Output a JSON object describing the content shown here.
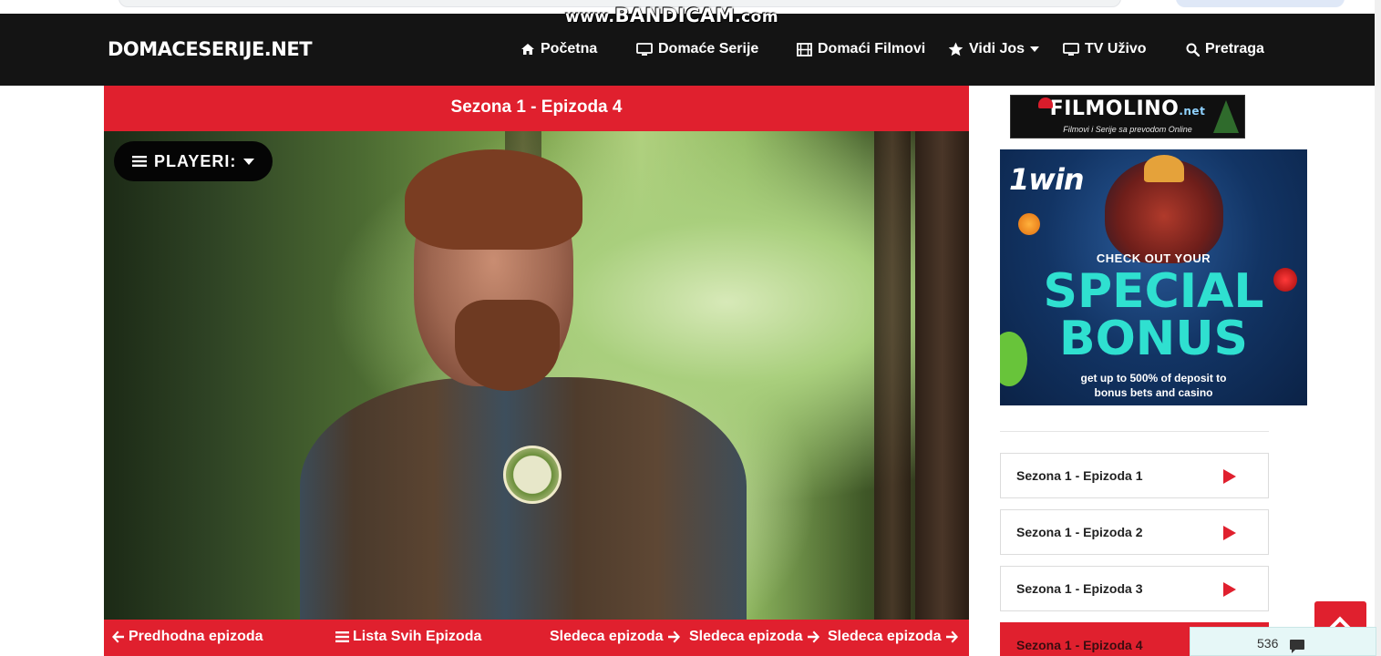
{
  "watermark": {
    "prefix": "www.",
    "brand": "BANDICAM",
    "suffix": ".com"
  },
  "site": {
    "logo": "DOMACESERIJE.NET"
  },
  "nav": [
    {
      "label": "Početna",
      "icon": "home-icon"
    },
    {
      "label": "Domaće Serije",
      "icon": "monitor-icon"
    },
    {
      "label": "Domaći Filmovi",
      "icon": "film-icon"
    },
    {
      "label": "Vidi Jos",
      "icon": "star-icon",
      "has_dropdown": true
    },
    {
      "label": "TV Uživo",
      "icon": "tv-icon"
    },
    {
      "label": "Pretraga",
      "icon": "search-icon"
    }
  ],
  "player": {
    "title": "Sezona 1 - Epizoda 4",
    "players_button": "PLAYERI:"
  },
  "episode_nav": {
    "prev": "Predhodna epizoda",
    "list": "Lista Svih Epizoda",
    "next_1": "Sledeca epizoda",
    "next_2": "Sledeca epizoda",
    "next_3": "Sledeca epizoda"
  },
  "sidebar": {
    "banner": {
      "brand": "FILMOLINO",
      "brand_suffix": ".net",
      "tagline": "Filmovi i Serije sa prevodom Online"
    },
    "ad": {
      "logo": "1win",
      "headline_small": "CHECK OUT YOUR",
      "headline_1": "SPECIAL",
      "headline_2": "BONUS",
      "line_1": "get up to 500% of deposit to",
      "line_2": "bonus bets and casino"
    },
    "episodes": [
      {
        "label": "Sezona 1 - Epizoda 1",
        "active": false
      },
      {
        "label": "Sezona 1 - Epizoda 2",
        "active": false
      },
      {
        "label": "Sezona 1 - Epizoda 3",
        "active": false
      },
      {
        "label": "Sezona 1 - Epizoda 4",
        "active": true
      }
    ]
  },
  "chat_widget": {
    "count": "536"
  },
  "colors": {
    "accent": "#e0202e",
    "navbar": "#141414",
    "ad_text": "#2fe0d0"
  }
}
